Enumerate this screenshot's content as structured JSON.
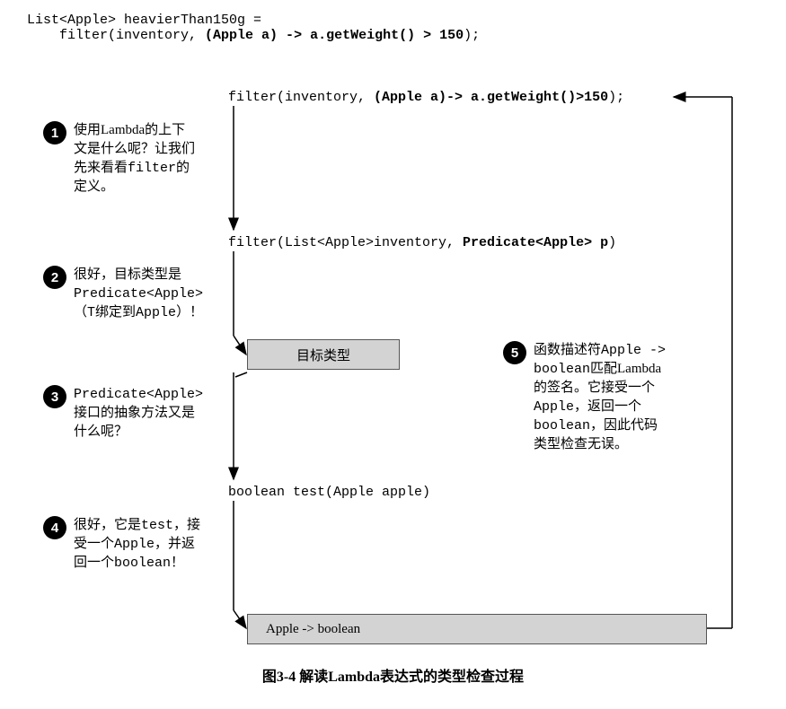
{
  "header_code": {
    "line1": "List<Apple> heavierThan150g =",
    "line2_prefix": "    filter(inventory, ",
    "line2_bold": "(Apple a) -> a.getWeight() > 150",
    "line2_suffix": ");"
  },
  "nodes": {
    "top_prefix": "filter(inventory, ",
    "top_bold": "(Apple a)-> a.getWeight()>150",
    "top_suffix": ");",
    "signature_prefix": "filter(List<Apple>inventory, ",
    "signature_bold": "Predicate<Apple> p",
    "signature_suffix": ")",
    "target_box": "目标类型",
    "test_method": "boolean test(Apple apple)",
    "final_box": "Apple -> boolean"
  },
  "steps": {
    "s1": {
      "num": "1",
      "l1": "使用Lambda的上下",
      "l2": "文是什么呢？让我们",
      "l3_a": "先来看看",
      "l3_code": "filter",
      "l3_b": "的",
      "l4": "定义。"
    },
    "s2": {
      "num": "2",
      "l1": "很好，目标类型是",
      "l2_code": "Predicate<Apple>",
      "l3_a": "（",
      "l3_code": "T",
      "l3_b": "绑定到",
      "l3_code2": "Apple",
      "l3_c": "）！"
    },
    "s3": {
      "num": "3",
      "l1_code": "Predicate<Apple>",
      "l2": "接口的抽象方法又是",
      "l3": "什么呢？"
    },
    "s4": {
      "num": "4",
      "l1_a": "很好，它是",
      "l1_code": "test",
      "l1_b": "，接",
      "l2_a": "受一个",
      "l2_code": "Apple",
      "l2_b": "，并返",
      "l3_a": "回一个",
      "l3_code": "boolean",
      "l3_b": "！"
    },
    "s5": {
      "num": "5",
      "l1_a": "函数描述符",
      "l1_code": "Apple ->",
      "l2_code": "boolean",
      "l2_b": "匹配Lambda",
      "l3": "的签名。它接受一个",
      "l4_code": "Apple",
      "l4_b": "，返回一个",
      "l5_code": "boolean",
      "l5_b": "，因此代码",
      "l6": "类型检查无误。"
    }
  },
  "caption": "图3-4    解读Lambda表达式的类型检查过程"
}
